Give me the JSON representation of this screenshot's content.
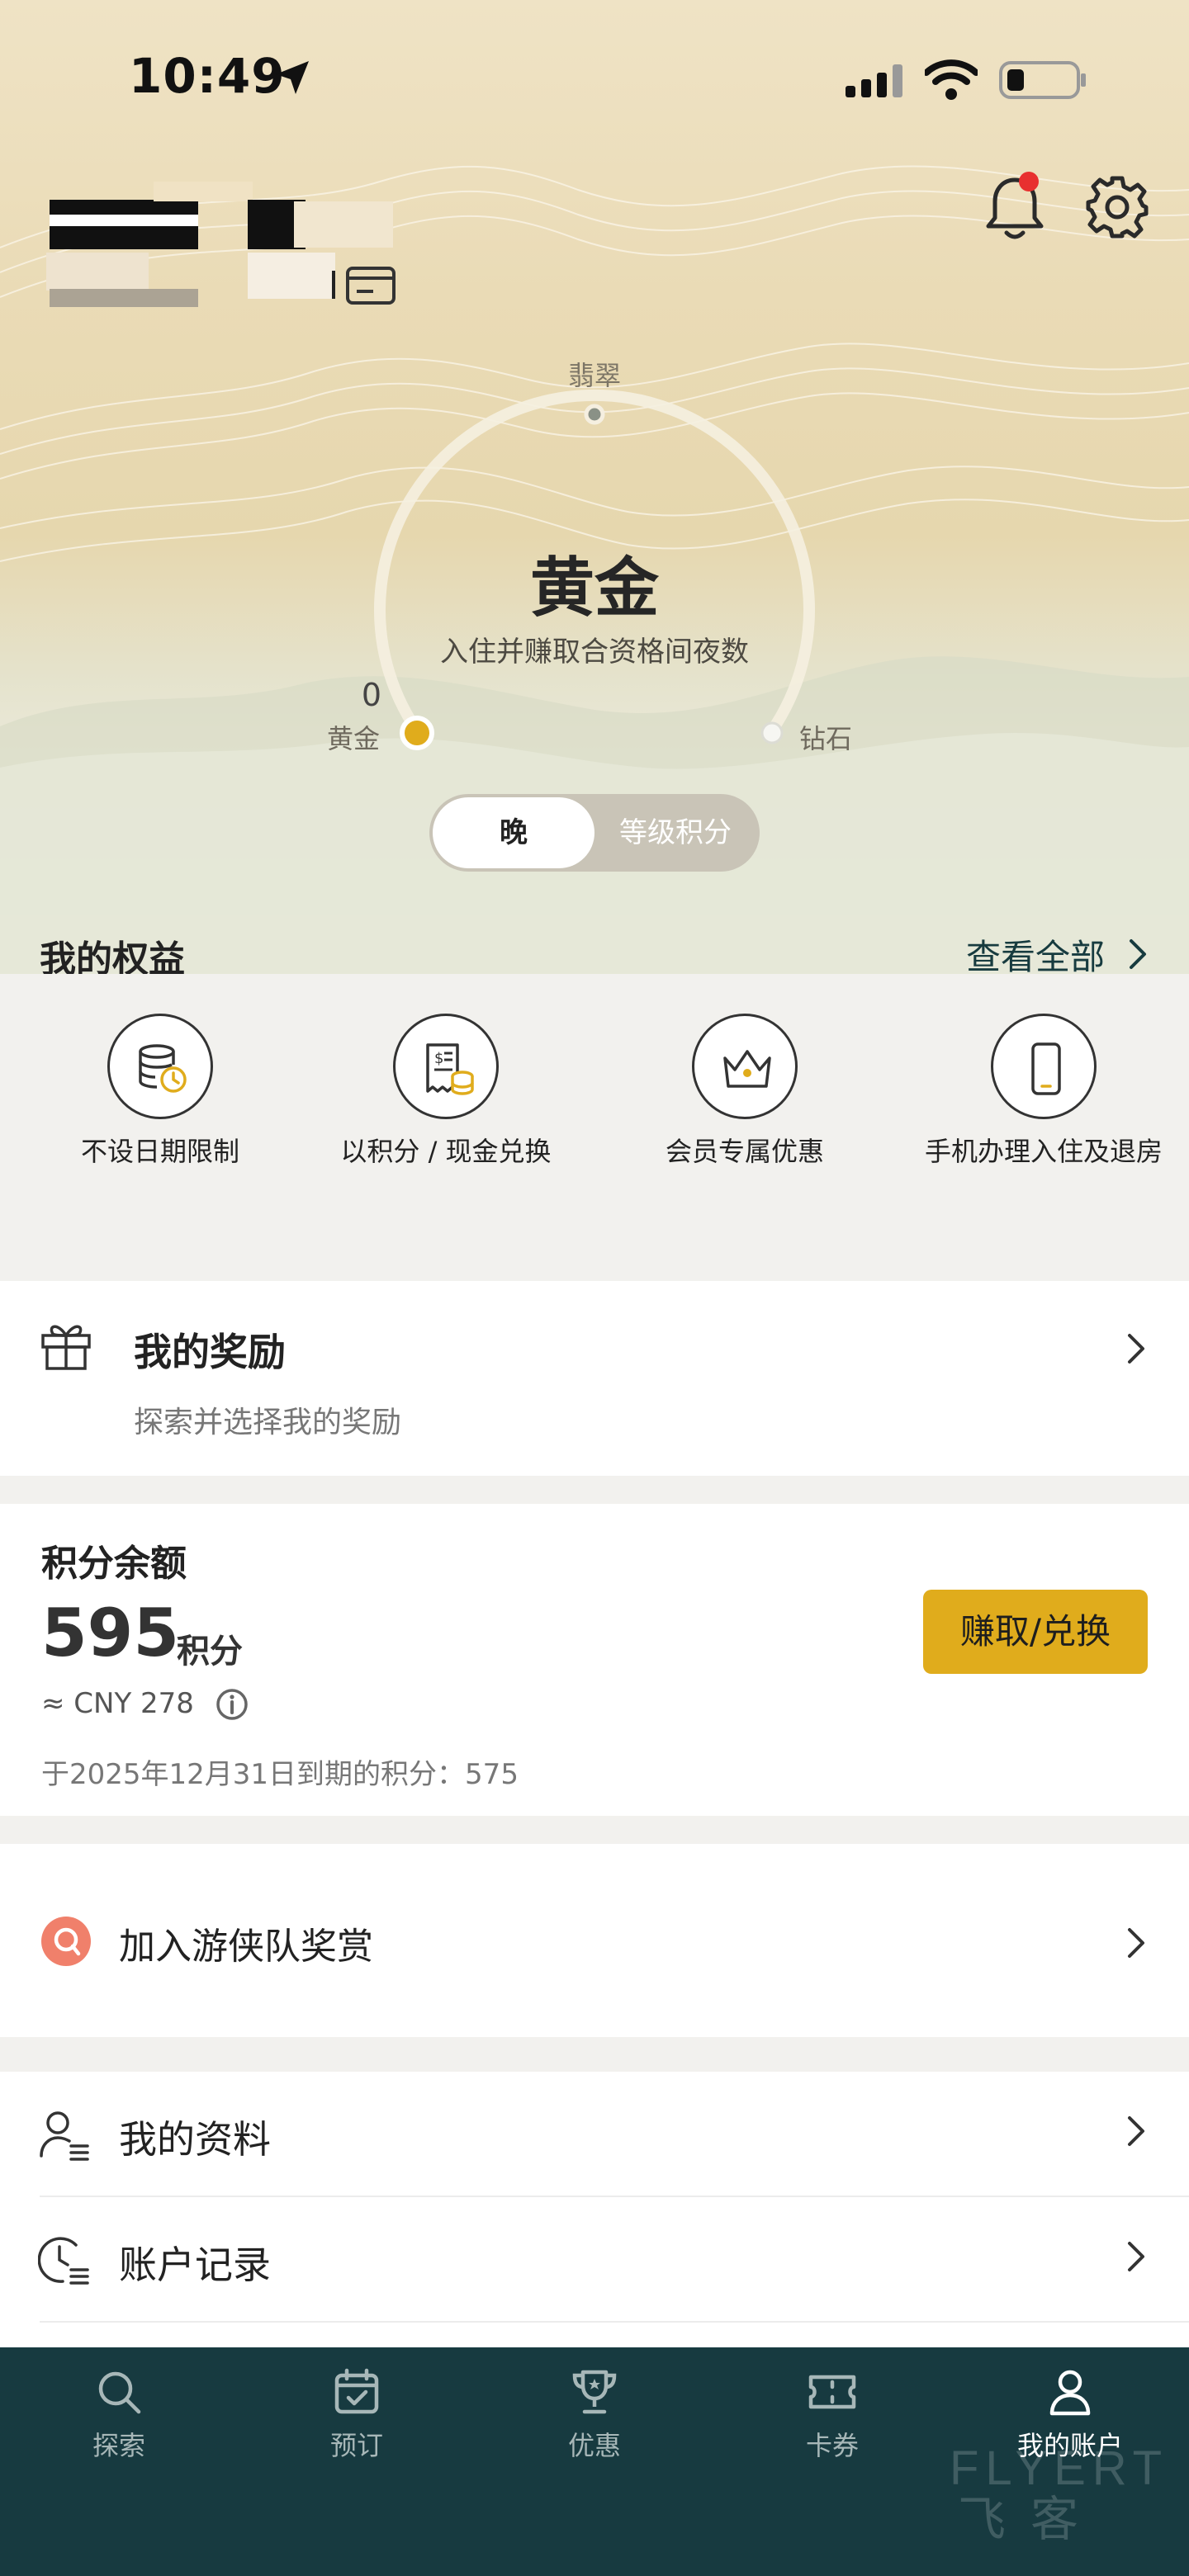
{
  "status_bar": {
    "time": "10:49"
  },
  "tier": {
    "next_label": "翡翠",
    "current": "黄金",
    "subtitle": "入住并赚取合资格间夜数",
    "progress_value": "0",
    "left_label": "黄金",
    "right_label": "钻石",
    "progress_fraction": 0
  },
  "toggle": {
    "active": "晚",
    "inactive": "等级积分"
  },
  "benefits": {
    "title": "我的权益",
    "view_all": "查看全部",
    "items": [
      {
        "label": "不设日期限制",
        "icon": "database-clock-icon"
      },
      {
        "label": "以积分 / 现金兑换",
        "icon": "receipt-coins-icon"
      },
      {
        "label": "会员专属优惠",
        "icon": "crown-icon"
      },
      {
        "label": "手机办理入住及退房",
        "icon": "mobile-phone-icon"
      }
    ]
  },
  "rewards": {
    "title": "我的奖励",
    "subtitle": "探索并选择我的奖励"
  },
  "points": {
    "title": "积分余额",
    "value": "595",
    "unit": "积分",
    "cny": "≈ CNY 278",
    "expire": "于2025年12月31日到期的积分：575",
    "button": "赚取/兑换"
  },
  "ranger": {
    "title": "加入游侠队奖赏"
  },
  "menu": [
    {
      "label": "我的资料",
      "icon": "profile-icon"
    },
    {
      "label": "账户记录",
      "icon": "history-icon"
    }
  ],
  "tabs": [
    {
      "label": "探索",
      "icon": "search-icon"
    },
    {
      "label": "预订",
      "icon": "calendar-check-icon"
    },
    {
      "label": "优惠",
      "icon": "trophy-icon"
    },
    {
      "label": "卡券",
      "icon": "ticket-icon"
    },
    {
      "label": "我的账户",
      "icon": "person-icon"
    }
  ],
  "colors": {
    "accent_gold": "#e0ac1c",
    "tabbar_bg": "#173a40",
    "alert_red": "#e8302f"
  },
  "watermark": {
    "line1": "FLYERT",
    "line2": "飞客"
  }
}
